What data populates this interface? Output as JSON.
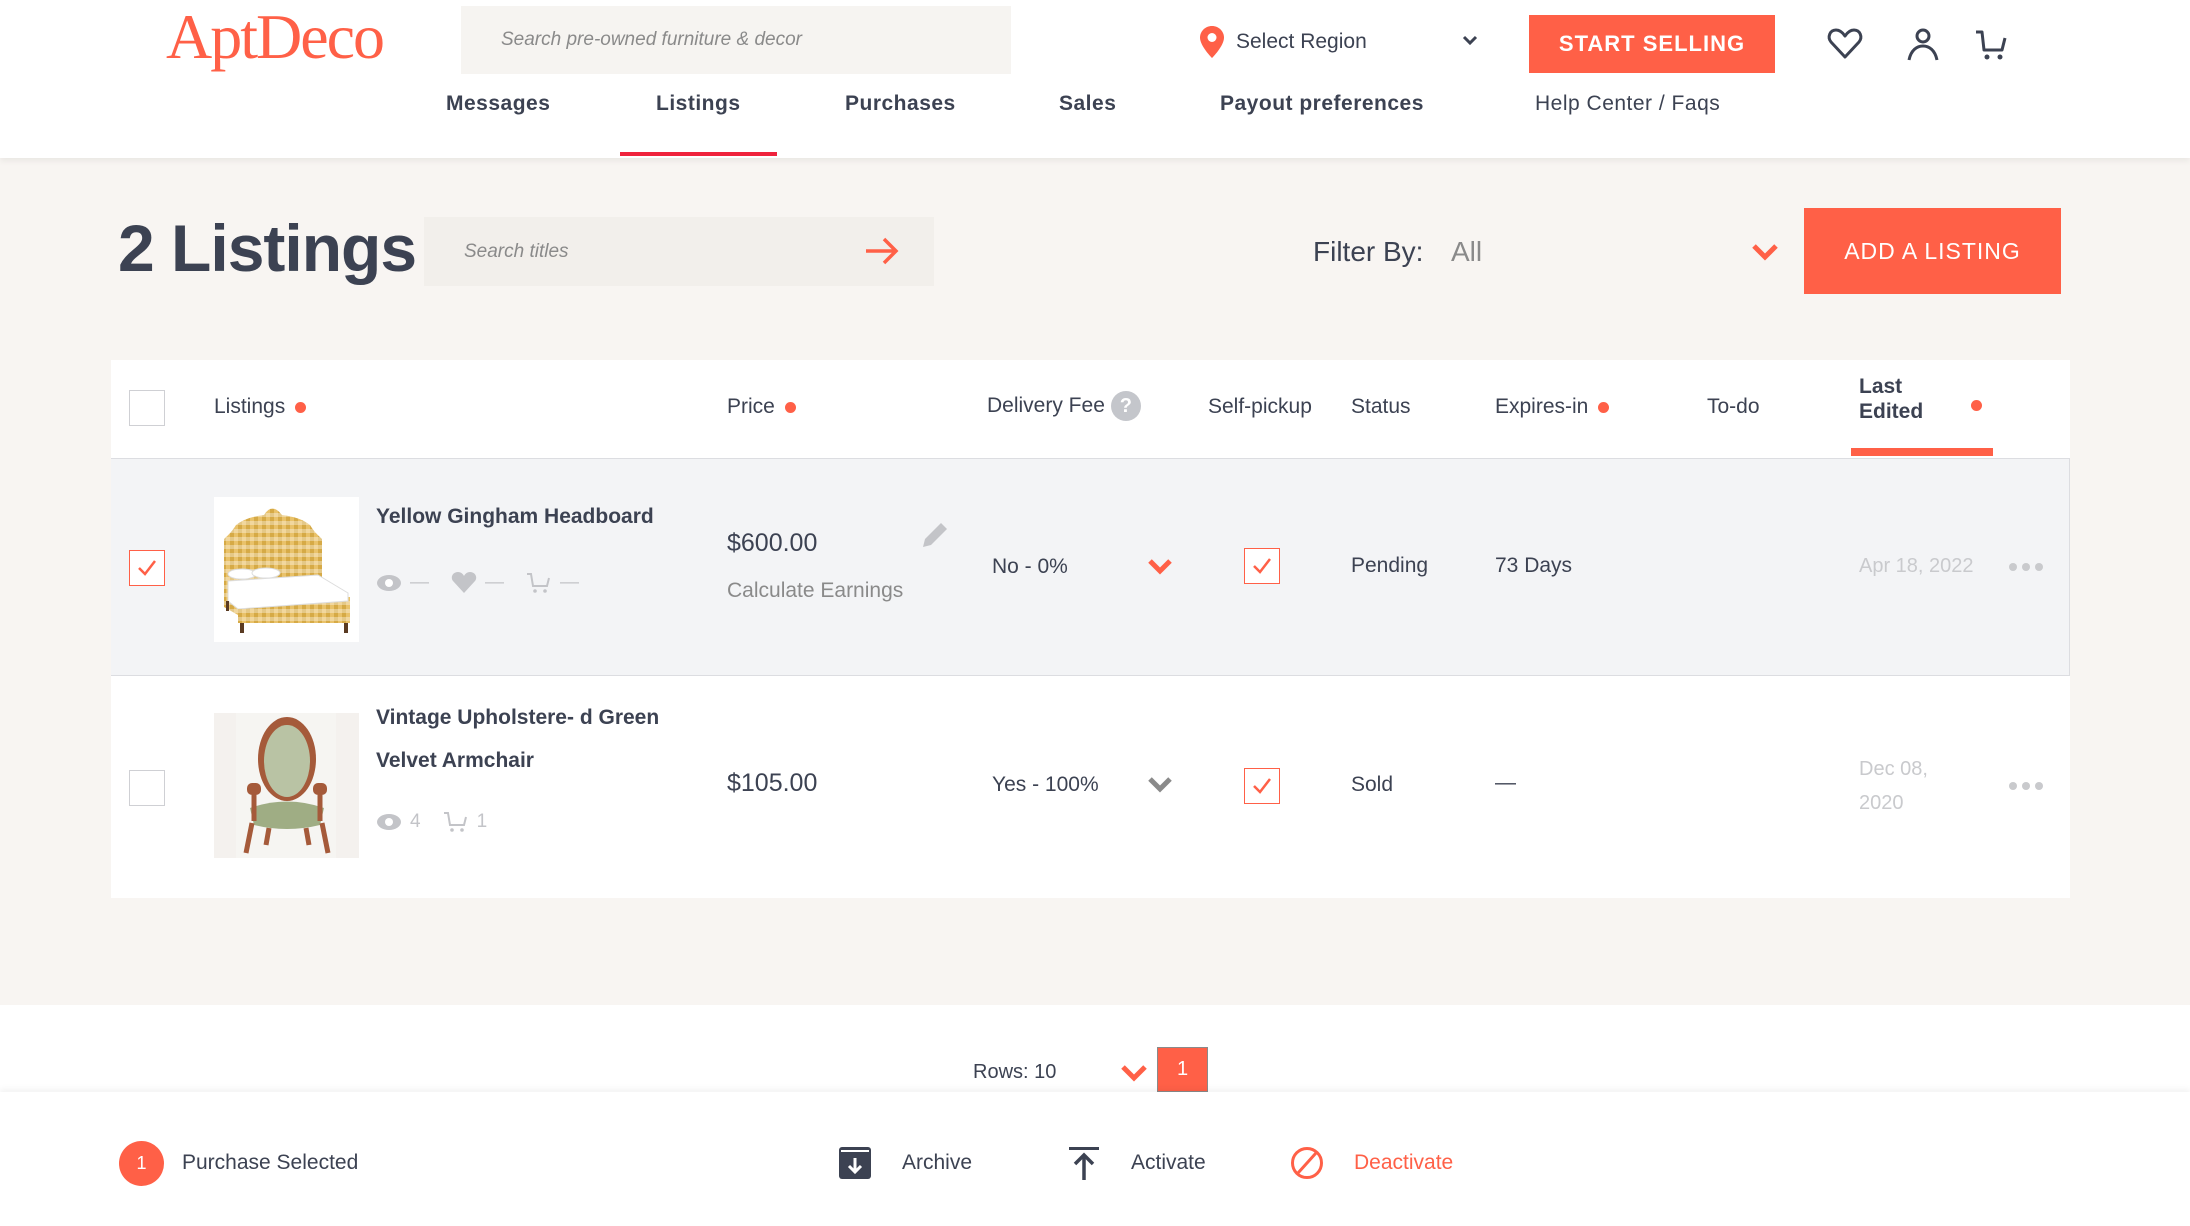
{
  "header": {
    "logo": "AptDeco",
    "search_placeholder": "Search pre-owned furniture & decor",
    "region_label": "Select Region",
    "start_selling": "START SELLING",
    "icons": [
      "heart-icon",
      "user-icon",
      "cart-icon"
    ]
  },
  "nav": {
    "items": [
      {
        "label": "Messages",
        "active": false
      },
      {
        "label": "Listings",
        "active": true
      },
      {
        "label": "Purchases",
        "active": false
      },
      {
        "label": "Sales",
        "active": false
      },
      {
        "label": "Payout preferences",
        "active": false
      },
      {
        "label": "Help Center / Faqs",
        "active": false
      }
    ]
  },
  "toolbar": {
    "title": "2 Listings",
    "search_placeholder": "Search titles",
    "filter_label": "Filter By:",
    "filter_value": "All",
    "add_listing": "ADD A LISTING"
  },
  "table": {
    "columns": {
      "listings": "Listings",
      "price": "Price",
      "delivery_fee": "Delivery Fee",
      "self_pickup": "Self-pickup",
      "status": "Status",
      "expires_in": "Expires-in",
      "todo": "To-do",
      "last_edited_1": "Last",
      "last_edited_2": "Edited"
    },
    "help_glyph": "?",
    "rows": [
      {
        "selected": true,
        "title": "Yellow Gingham Headboard",
        "views": "—",
        "likes": "—",
        "carts": "—",
        "price": "$600.00",
        "calc_earnings": "Calculate Earnings",
        "delivery": "No - 0%",
        "self_pickup": true,
        "status": "Pending",
        "expires": "73 Days",
        "todo": "",
        "last_edited": "Apr 18, 2022"
      },
      {
        "selected": false,
        "title_line1": "Vintage Upholstere- d Green",
        "title_line2": "Velvet Armchair",
        "views": "4",
        "carts": "1",
        "price": "$105.00",
        "delivery": "Yes - 100%",
        "self_pickup": true,
        "status": "Sold",
        "expires": "—",
        "todo": "",
        "last_edited_1": "Dec 08,",
        "last_edited_2": "2020"
      }
    ]
  },
  "pagination": {
    "rows_label": "Rows: 10",
    "current_page": "1"
  },
  "actionbar": {
    "selected_count": "1",
    "selected_label": "Purchase Selected",
    "archive": "Archive",
    "activate": "Activate",
    "deactivate": "Deactivate"
  },
  "colors": {
    "accent": "#ff6047",
    "text": "#3c4252",
    "muted": "#8a8a8a",
    "page_bg": "#f8f5f2",
    "selected_row": "#f3f4f6"
  }
}
